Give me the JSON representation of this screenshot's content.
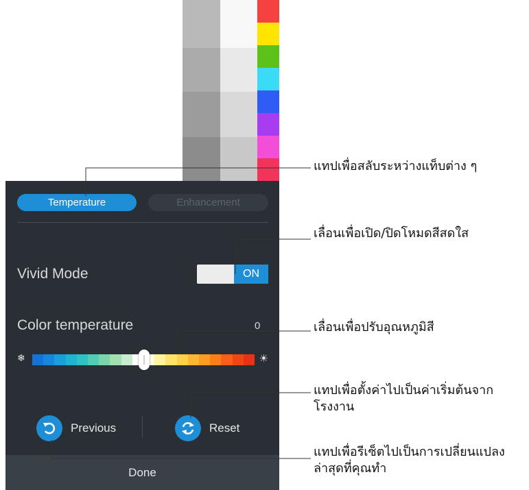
{
  "tabs": {
    "temperature": "Temperature",
    "enhancement": "Enhancement"
  },
  "vivid_mode": {
    "label": "Vivid Mode",
    "toggle_state": "ON"
  },
  "color_temperature": {
    "label": "Color temperature",
    "value": "0",
    "cold_icon": "snowflake-icon",
    "warm_icon": "sun-icon"
  },
  "actions": {
    "previous": "Previous",
    "reset": "Reset",
    "done": "Done",
    "previous_icon": "undo-icon",
    "reset_icon": "refresh-icon"
  },
  "callouts": {
    "switch_tabs": "แทปเพื่อสลับระหว่างแท็บต่าง ๆ",
    "vivid_toggle": "เลื่อนเพื่อเปิด/ปิดโหมดสีสดใส",
    "adjust_temperature": "เลื่อนเพื่อปรับอุณหภูมิสี",
    "reset_factory": "แทปเพื่อตั้งค่าไปเป็นค่าเริ่มต้นจากโรงงาน",
    "previous_changes": "แทปเพื่อรีเซ็ตไปเป็นการเปลี่ยนแปลงล่าสุดที่คุณทำ"
  },
  "colors": {
    "accent": "#1e8fd6",
    "panel_bg": "#2a2f36",
    "done_bg": "#3a4048",
    "gray_swatches_a": [
      "#b9b9b9",
      "#ababab",
      "#9c9c9c",
      "#8c8c8c"
    ],
    "gray_swatches_b": [
      "#f8f8f8",
      "#e9e9e9",
      "#d9d9d9",
      "#c8c8c8"
    ],
    "color_swatches": [
      "#f64141",
      "#ffe400",
      "#5cc21a",
      "#3adbf6",
      "#2f5cf4",
      "#a83cf0",
      "#f24fd6",
      "#f2335a"
    ],
    "slider_gradient": [
      "#1472d8",
      "#1687db",
      "#1aa0d9",
      "#20b4d0",
      "#2ec2c2",
      "#52ccb4",
      "#78d6a8",
      "#a2e0b0",
      "#c8ecd0",
      "#ffffff",
      "#fffde0",
      "#fff3a0",
      "#ffe36a",
      "#ffd04a",
      "#ffb832",
      "#ff9c24",
      "#ff7e1c",
      "#fb5e18",
      "#f24516",
      "#e83218"
    ]
  }
}
